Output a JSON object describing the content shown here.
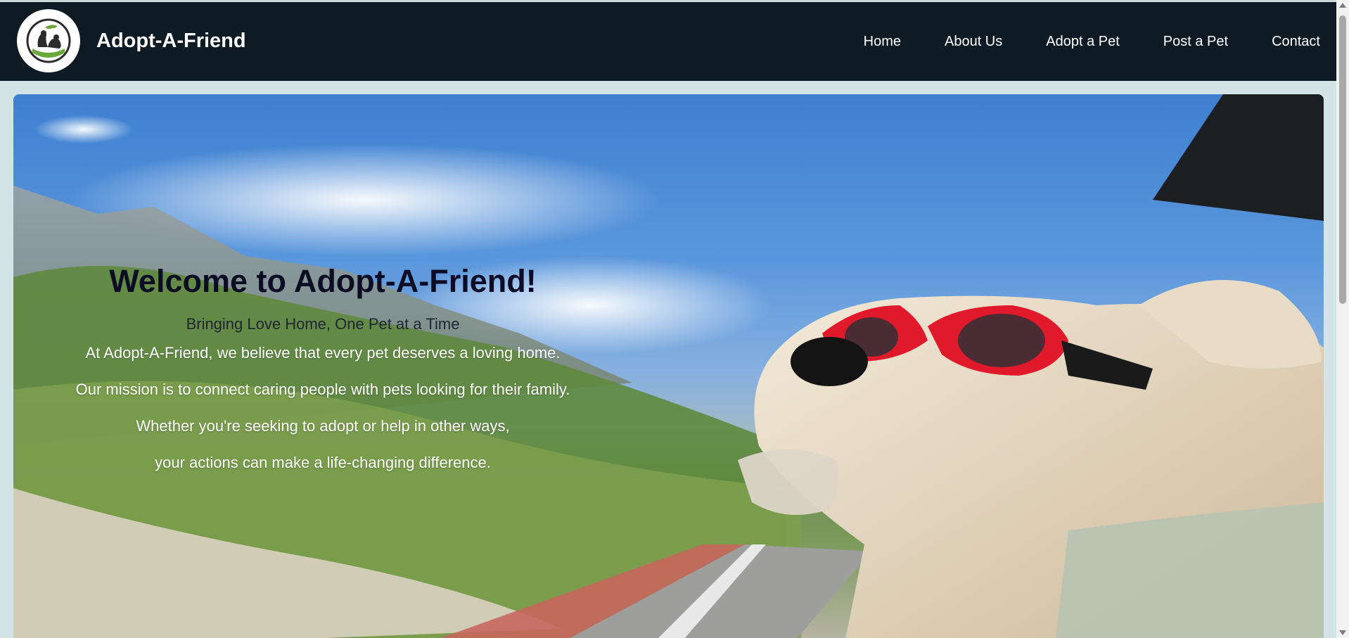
{
  "header": {
    "brand": "Adopt-A-Friend",
    "logo_icon": "pet-logo-icon",
    "nav": [
      {
        "label": "Home"
      },
      {
        "label": "About Us"
      },
      {
        "label": "Adopt a Pet"
      },
      {
        "label": "Post a Pet"
      },
      {
        "label": "Contact"
      }
    ]
  },
  "hero": {
    "title": "Welcome to Adopt-A-Friend!",
    "subtitle": "Bringing Love Home, One Pet at a Time",
    "lines": [
      "At Adopt-A-Friend, we believe that every pet deserves a loving home.",
      "Our mission is to connect caring people with pets looking for their family.",
      "Whether you're seeking to adopt or help in other ways,",
      "your actions can make a life-changing difference."
    ],
    "image": "dog-with-goggles-in-car-window"
  },
  "colors": {
    "navbar_bg": "#0e1a24",
    "page_bg": "#d4e4e6",
    "title_color": "#0c0c24",
    "goggles_red": "#e0192b"
  }
}
